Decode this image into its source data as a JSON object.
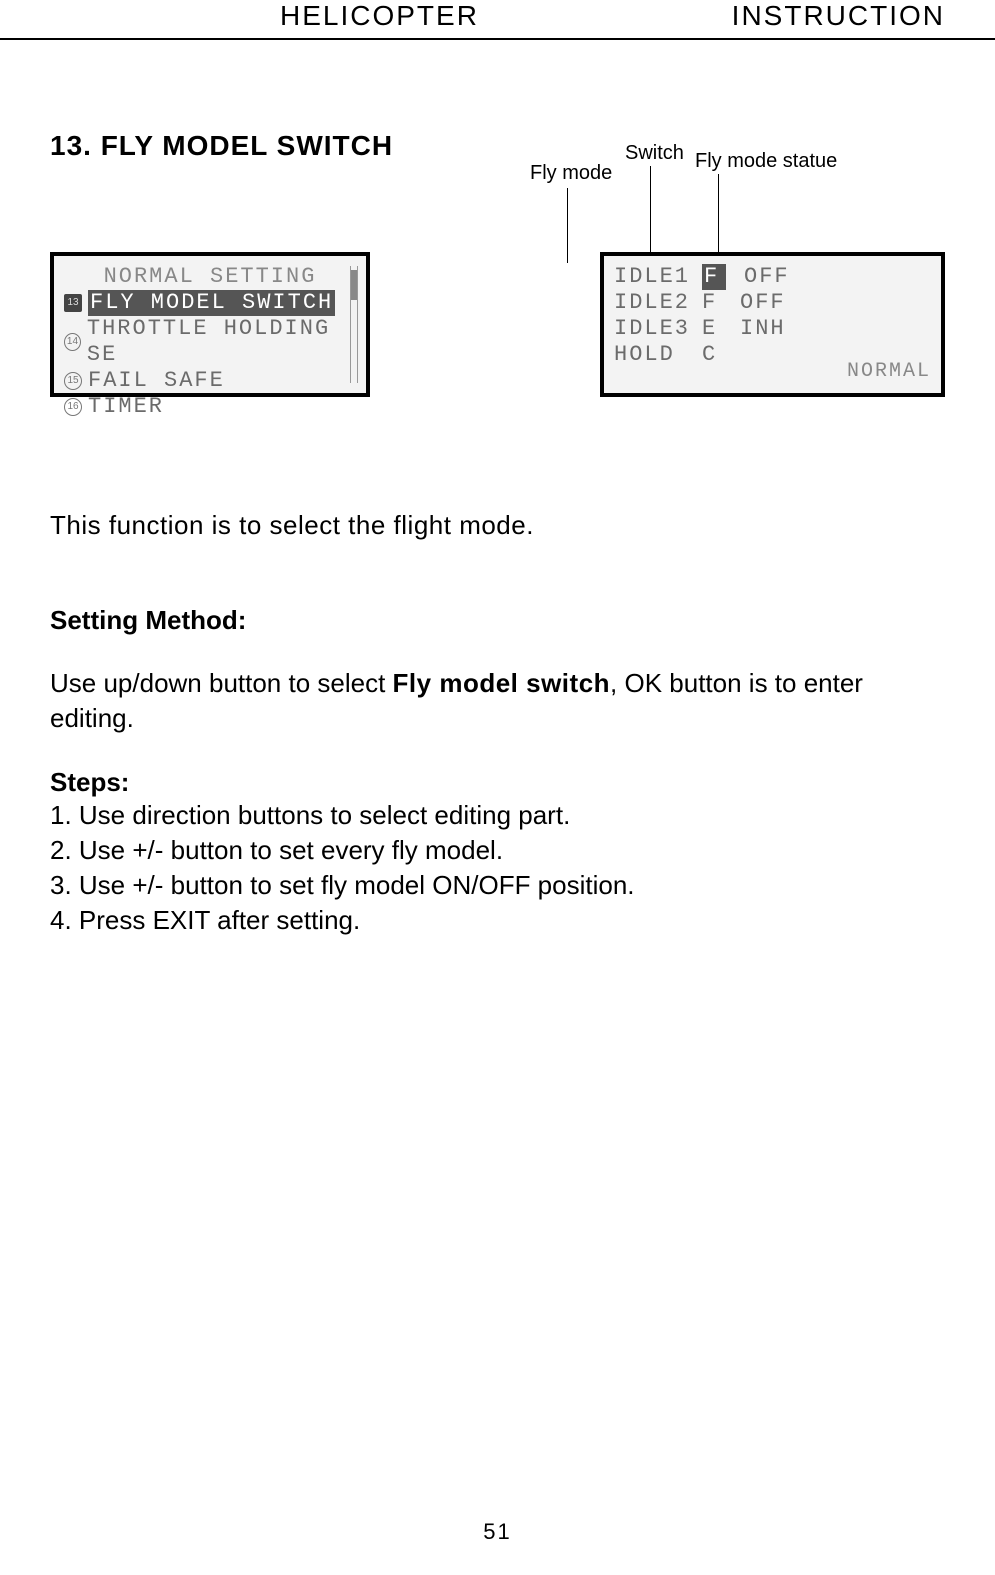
{
  "header": {
    "left": "HELICOPTER",
    "right": "INSTRUCTION"
  },
  "section_title": "13. FLY MODEL SWITCH",
  "callouts": {
    "fly_mode": "Fly mode",
    "switch": "Switch",
    "fly_mode_statue": "Fly mode statue"
  },
  "left_screen": {
    "title": "NORMAL SETTING",
    "items": [
      {
        "num": "13",
        "label": "FLY MODEL SWITCH",
        "selected": true
      },
      {
        "num": "14",
        "label": "THROTTLE HOLDING SE",
        "selected": false
      },
      {
        "num": "15",
        "label": "FAIL SAFE",
        "selected": false
      },
      {
        "num": "16",
        "label": "TIMER",
        "selected": false
      }
    ]
  },
  "right_screen": {
    "rows": [
      {
        "mode": "IDLE1",
        "sw": "F",
        "status": "OFF",
        "sw_inv": true
      },
      {
        "mode": "IDLE2",
        "sw": "F",
        "status": "OFF",
        "sw_inv": false
      },
      {
        "mode": "IDLE3",
        "sw": "E",
        "status": "INH",
        "sw_inv": false
      },
      {
        "mode": "HOLD",
        "sw": "C",
        "status": "",
        "sw_inv": false
      }
    ],
    "footer": "NORMAL"
  },
  "intro": "This function is to select the flight mode.",
  "setting_head": "Setting Method:",
  "setting_body_pre": "Use up/down button to select ",
  "setting_body_bold": "Fly model switch",
  "setting_body_post": ", OK button is to enter editing.",
  "steps_head": "Steps:",
  "steps": [
    "1. Use direction buttons to select editing part.",
    "2. Use +/- button to set every fly model.",
    "3. Use +/- button to set fly model ON/OFF position.",
    "4. Press EXIT after setting."
  ],
  "page_number": "51"
}
